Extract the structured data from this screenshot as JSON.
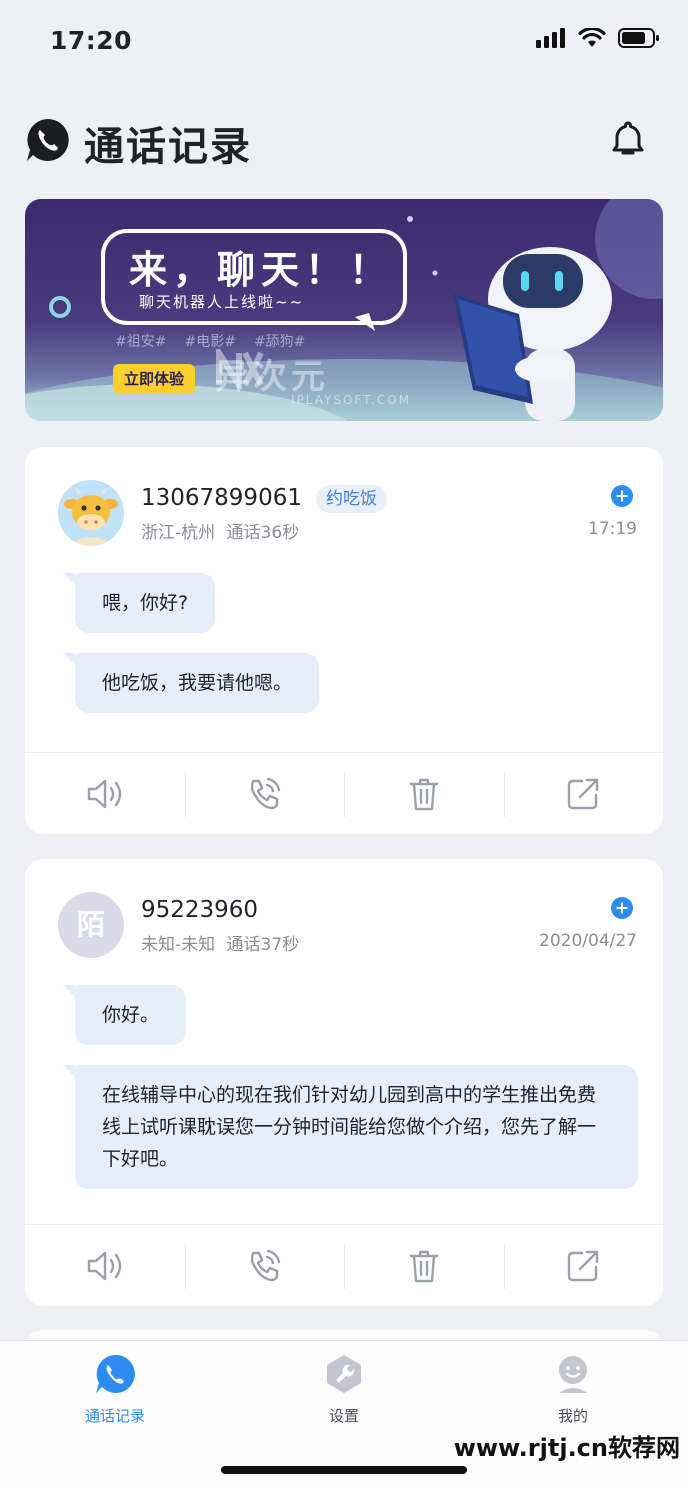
{
  "status_bar": {
    "time": "17:20"
  },
  "header": {
    "title": "通话记录"
  },
  "banner": {
    "headline": "来，聊天！！",
    "subtitle": "聊天机器人上线啦~~",
    "tags": [
      "#祖安#",
      "#电影#",
      "#舔狗#"
    ],
    "cta": "立即体验",
    "watermark_cn": "异次元",
    "watermark_en": "IPLAYSOFT.COM"
  },
  "calls": [
    {
      "number": "13067899061",
      "tag": "约吃饭",
      "location": "浙江-杭州",
      "duration": "通话36秒",
      "time": "17:19",
      "messages": [
        "喂，你好?",
        "他吃饭，我要请他嗯。"
      ]
    },
    {
      "number": "95223960",
      "avatar_text": "陌",
      "location": "未知-未知",
      "duration": "通话37秒",
      "time": "2020/04/27",
      "messages": [
        "你好。",
        "在线辅导中心的现在我们针对幼儿园到高中的学生推出免费线上试听课耽误您一分钟时间能给您做个介绍，您先了解一下好吧。"
      ]
    }
  ],
  "action_icons": [
    "speaker-icon",
    "phone-call-icon",
    "trash-icon",
    "share-icon"
  ],
  "tabbar": {
    "tabs": [
      {
        "label": "通话记录",
        "icon": "phone-bubble-icon",
        "active": true
      },
      {
        "label": "设置",
        "icon": "wrench-icon",
        "active": false
      },
      {
        "label": "我的",
        "icon": "user-face-icon",
        "active": false
      }
    ]
  },
  "site_watermark": "www.rjtj.cn软荐网",
  "colors": {
    "accent": "#2d8cf0",
    "background": "#eef0f6",
    "bubble": "#e5eefa",
    "cta": "#ffcf2e"
  }
}
